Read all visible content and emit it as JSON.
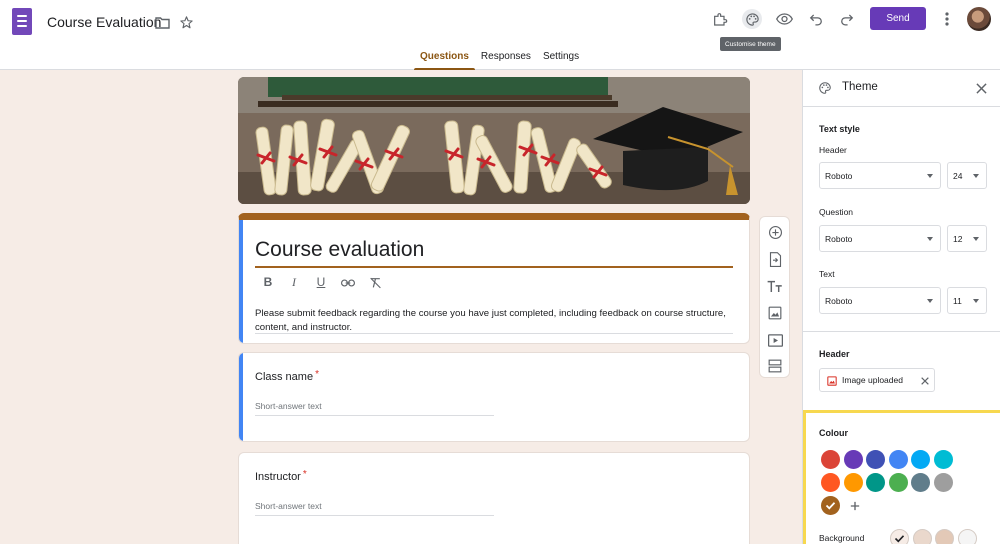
{
  "header": {
    "doc_title": "Course Evaluation",
    "send_label": "Send",
    "tooltip": "Customise theme",
    "tabs": [
      {
        "label": "Questions",
        "active": true
      },
      {
        "label": "Responses",
        "active": false
      },
      {
        "label": "Settings",
        "active": false
      }
    ],
    "icons": [
      "forms-logo-icon",
      "folder-icon",
      "star-icon",
      "addon-puzzle-icon",
      "palette-icon",
      "preview-eye-icon",
      "undo-icon",
      "redo-icon",
      "more-vert-icon"
    ]
  },
  "form": {
    "title": "Course evaluation",
    "description": "Please submit feedback regarding the course you have just completed, including feedback on course structure, content, and instructor.",
    "format_tools": [
      "B",
      "I",
      "U"
    ],
    "questions": [
      {
        "title": "Class name",
        "required": "*",
        "placeholder": "Short-answer text"
      },
      {
        "title": "Instructor",
        "required": "*",
        "placeholder": "Short-answer text"
      }
    ]
  },
  "floating_toolbar": [
    "add-question-icon",
    "import-questions-icon",
    "add-title-icon",
    "add-image-icon",
    "add-video-icon",
    "add-section-icon"
  ],
  "theme_panel": {
    "title": "Theme",
    "text_style_label": "Text style",
    "header": {
      "label": "Header",
      "font": "Roboto",
      "size": "24"
    },
    "question": {
      "label": "Question",
      "font": "Roboto",
      "size": "12"
    },
    "text": {
      "label": "Text",
      "font": "Roboto",
      "size": "11"
    },
    "header_image_label": "Header",
    "image_chip": "Image uploaded",
    "colour_label": "Colour",
    "colours": [
      "#db4437",
      "#673ab7",
      "#3f51b5",
      "#4285f4",
      "#03a9f4",
      "#00bcd4",
      "#ff5722",
      "#ff9800",
      "#009688",
      "#4caf50",
      "#607d8b",
      "#9e9e9e",
      "#a2621e"
    ],
    "selected_colour": "#a2621e",
    "background_label": "Background",
    "backgrounds": [
      "#f6ece6",
      "#ead8cc",
      "#e3c9b7",
      "#f5f5f5"
    ],
    "selected_background": "#f6ece6"
  },
  "accent_color": "#a2621e",
  "brand_color": "#673ab7"
}
